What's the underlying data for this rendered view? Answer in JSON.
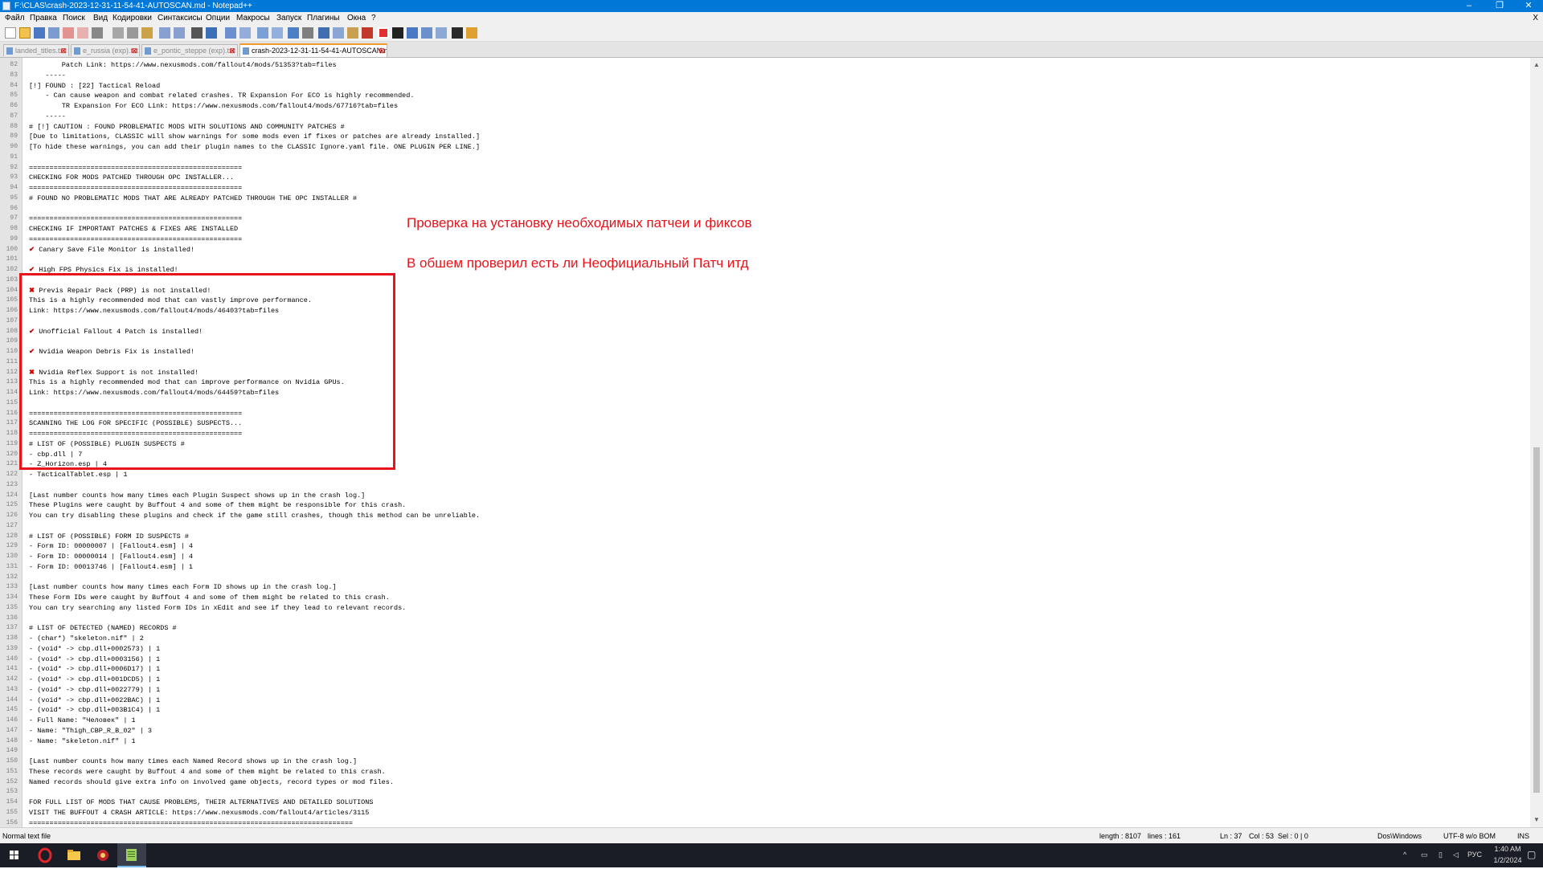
{
  "window": {
    "title": "F:\\CLAS\\crash-2023-12-31-11-54-41-AUTOSCAN.md - Notepad++",
    "minimize": "–",
    "maximize": "❐",
    "close": "✕"
  },
  "menu": {
    "items": [
      "Файл",
      "Правка",
      "Поиск",
      "Вид",
      "Кодировки",
      "Синтаксисы",
      "Опции",
      "Макросы",
      "Запуск",
      "Плагины",
      "Окна",
      "?"
    ],
    "close": "X"
  },
  "tabs": [
    {
      "label": "landed_titles.txt"
    },
    {
      "label": "e_russia (exp).txt"
    },
    {
      "label": "e_pontic_steppe (exp).txt"
    },
    {
      "label": "crash-2023-12-31-11-54-41-AUTOSCAN.md"
    }
  ],
  "editor": {
    "lines": [
      {
        "n": "82",
        "t": "        Patch Link: https://www.nexusmods.com/fallout4/mods/51353?tab=files"
      },
      {
        "n": "83",
        "t": "    -----"
      },
      {
        "n": "84",
        "t": "[!] FOUND : [22] Tactical Reload"
      },
      {
        "n": "85",
        "t": "    - Can cause weapon and combat related crashes. TR Expansion For ECO is highly recommended."
      },
      {
        "n": "86",
        "t": "        TR Expansion For ECO Link: https://www.nexusmods.com/fallout4/mods/67716?tab=files"
      },
      {
        "n": "87",
        "t": "    -----"
      },
      {
        "n": "88",
        "t": "# [!] CAUTION : FOUND PROBLEMATIC MODS WITH SOLUTIONS AND COMMUNITY PATCHES #"
      },
      {
        "n": "89",
        "t": "[Due to limitations, CLASSIC will show warnings for some mods even if fixes or patches are already installed.]"
      },
      {
        "n": "90",
        "t": "[To hide these warnings, you can add their plugin names to the CLASSIC Ignore.yaml file. ONE PLUGIN PER LINE.]"
      },
      {
        "n": "91",
        "t": ""
      },
      {
        "n": "92",
        "t": "===================================================="
      },
      {
        "n": "93",
        "t": "CHECKING FOR MODS PATCHED THROUGH OPC INSTALLER..."
      },
      {
        "n": "94",
        "t": "===================================================="
      },
      {
        "n": "95",
        "t": "# FOUND NO PROBLEMATIC MODS THAT ARE ALREADY PATCHED THROUGH THE OPC INSTALLER #"
      },
      {
        "n": "96",
        "t": ""
      },
      {
        "n": "97",
        "t": "===================================================="
      },
      {
        "n": "98",
        "t": "CHECKING IF IMPORTANT PATCHES & FIXES ARE INSTALLED"
      },
      {
        "n": "99",
        "t": "===================================================="
      },
      {
        "n": "100",
        "t": "✔ Canary Save File Monitor is installed!"
      },
      {
        "n": "101",
        "t": ""
      },
      {
        "n": "102",
        "t": "✔ High FPS Physics Fix is installed!"
      },
      {
        "n": "103",
        "t": ""
      },
      {
        "n": "104",
        "t": "✖ Previs Repair Pack (PRP) is not installed!"
      },
      {
        "n": "105",
        "t": "This is a highly recommended mod that can vastly improve performance."
      },
      {
        "n": "106",
        "t": "Link: https://www.nexusmods.com/fallout4/mods/46403?tab=files"
      },
      {
        "n": "107",
        "t": ""
      },
      {
        "n": "108",
        "t": "✔ Unofficial Fallout 4 Patch is installed!"
      },
      {
        "n": "109",
        "t": ""
      },
      {
        "n": "110",
        "t": "✔ Nvidia Weapon Debris Fix is installed!"
      },
      {
        "n": "111",
        "t": ""
      },
      {
        "n": "112",
        "t": "✖ Nvidia Reflex Support is not installed!"
      },
      {
        "n": "113",
        "t": "This is a highly recommended mod that can improve performance on Nvidia GPUs."
      },
      {
        "n": "114",
        "t": "Link: https://www.nexusmods.com/fallout4/mods/64459?tab=files"
      },
      {
        "n": "115",
        "t": ""
      },
      {
        "n": "116",
        "t": "===================================================="
      },
      {
        "n": "117",
        "t": "SCANNING THE LOG FOR SPECIFIC (POSSIBLE) SUSPECTS..."
      },
      {
        "n": "118",
        "t": "===================================================="
      },
      {
        "n": "119",
        "t": "# LIST OF (POSSIBLE) PLUGIN SUSPECTS #"
      },
      {
        "n": "120",
        "t": "- cbp.dll | 7"
      },
      {
        "n": "121",
        "t": "- Z_Horizon.esp | 4"
      },
      {
        "n": "122",
        "t": "- TacticalTablet.esp | 1"
      },
      {
        "n": "123",
        "t": ""
      },
      {
        "n": "124",
        "t": "[Last number counts how many times each Plugin Suspect shows up in the crash log.]"
      },
      {
        "n": "125",
        "t": "These Plugins were caught by Buffout 4 and some of them might be responsible for this crash."
      },
      {
        "n": "126",
        "t": "You can try disabling these plugins and check if the game still crashes, though this method can be unreliable."
      },
      {
        "n": "127",
        "t": ""
      },
      {
        "n": "128",
        "t": "# LIST OF (POSSIBLE) FORM ID SUSPECTS #"
      },
      {
        "n": "129",
        "t": "- Form ID: 00000007 | [Fallout4.esm] | 4"
      },
      {
        "n": "130",
        "t": "- Form ID: 00000014 | [Fallout4.esm] | 4"
      },
      {
        "n": "131",
        "t": "- Form ID: 00013746 | [Fallout4.esm] | 1"
      },
      {
        "n": "132",
        "t": ""
      },
      {
        "n": "133",
        "t": "[Last number counts how many times each Form ID shows up in the crash log.]"
      },
      {
        "n": "134",
        "t": "These Form IDs were caught by Buffout 4 and some of them might be related to this crash."
      },
      {
        "n": "135",
        "t": "You can try searching any listed Form IDs in xEdit and see if they lead to relevant records."
      },
      {
        "n": "136",
        "t": ""
      },
      {
        "n": "137",
        "t": "# LIST OF DETECTED (NAMED) RECORDS #"
      },
      {
        "n": "138",
        "t": "- (char*) \"skeleton.nif\" | 2"
      },
      {
        "n": "139",
        "t": "- (void* -> cbp.dll+0002573) | 1"
      },
      {
        "n": "140",
        "t": "- (void* -> cbp.dll+0003156) | 1"
      },
      {
        "n": "141",
        "t": "- (void* -> cbp.dll+0006D17) | 1"
      },
      {
        "n": "142",
        "t": "- (void* -> cbp.dll+001DCD5) | 1"
      },
      {
        "n": "143",
        "t": "- (void* -> cbp.dll+0022779) | 1"
      },
      {
        "n": "144",
        "t": "- (void* -> cbp.dll+0022BAC) | 1"
      },
      {
        "n": "145",
        "t": "- (void* -> cbp.dll+003B1C4) | 1"
      },
      {
        "n": "146",
        "t": "- Full Name: \"Человек\" | 1"
      },
      {
        "n": "147",
        "t": "- Name: \"Thigh_CBP_R_B_02\" | 3"
      },
      {
        "n": "148",
        "t": "- Name: \"skeleton.nif\" | 1"
      },
      {
        "n": "149",
        "t": ""
      },
      {
        "n": "150",
        "t": "[Last number counts how many times each Named Record shows up in the crash log.]"
      },
      {
        "n": "151",
        "t": "These records were caught by Buffout 4 and some of them might be related to this crash."
      },
      {
        "n": "152",
        "t": "Named records should give extra info on involved game objects, record types or mod files."
      },
      {
        "n": "153",
        "t": ""
      },
      {
        "n": "154",
        "t": "FOR FULL LIST OF MODS THAT CAUSE PROBLEMS, THEIR ALTERNATIVES AND DETAILED SOLUTIONS"
      },
      {
        "n": "155",
        "t": "VISIT THE BUFFOUT 4 CRASH ARTICLE: https://www.nexusmods.com/fallout4/articles/3115"
      },
      {
        "n": "156",
        "t": "==============================================================================="
      }
    ],
    "annotation_1": "Проверка на установку необходимых патчеи и фиксов",
    "annotation_2": "В обшем проверил есть ли Неофициальный Патч итд"
  },
  "statusbar": {
    "file_type": "Normal text file",
    "length": "length : 8107",
    "lines": "lines : 161",
    "ln": "Ln : 37",
    "col": "Col : 53",
    "sel": "Sel : 0 | 0",
    "eol": "Dos\\Windows",
    "encoding": "UTF-8 w/o BOM",
    "mode": "INS"
  },
  "taskbar": {
    "lang": "РУС",
    "time": "1:40 AM",
    "date": "1/2/2024"
  }
}
